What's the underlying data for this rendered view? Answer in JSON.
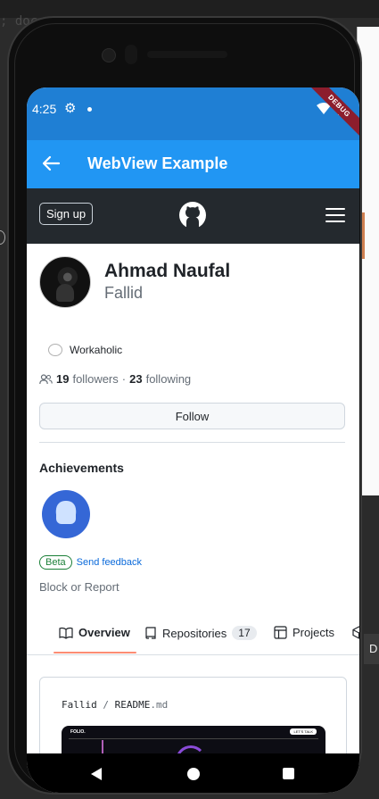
{
  "background": {
    "code_snippet": "; docs:",
    "right_tab": "D"
  },
  "status_bar": {
    "time": "4:25",
    "debug_label": "DEBUG"
  },
  "app_bar": {
    "title": "WebView Example"
  },
  "github_header": {
    "signup_label": "Sign up"
  },
  "profile": {
    "name": "Ahmad Naufal",
    "login": "Fallid",
    "status": "Workaholic",
    "followers_count": "19",
    "followers_label": "followers",
    "separator": "·",
    "following_count": "23",
    "following_label": "following",
    "follow_button": "Follow"
  },
  "achievements": {
    "title": "Achievements",
    "beta_label": "Beta",
    "feedback_label": "Send feedback"
  },
  "block_report": "Block or Report",
  "tabs": [
    {
      "label": "Overview"
    },
    {
      "label": "Repositories",
      "count": "17"
    },
    {
      "label": "Projects"
    }
  ],
  "readme": {
    "owner": "Fallid",
    "slash": "/",
    "file": "README",
    "ext": ".md",
    "preview_logo": "FOLIO.",
    "preview_button": "LET'S TALK"
  },
  "colors": {
    "status_bar": "#1f7fd4",
    "app_bar": "#2196f3",
    "github_header": "#24292e",
    "tab_underline": "#fd8c73",
    "link": "#0969da",
    "beta_green": "#1a7f37"
  }
}
